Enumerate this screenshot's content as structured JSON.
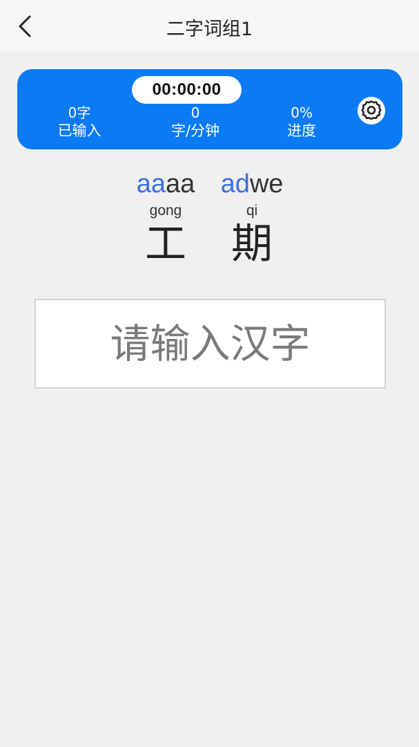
{
  "header": {
    "title": "二字词组1",
    "back_icon": "chevron-left-icon"
  },
  "stats": {
    "timer": "00:00:00",
    "typed_value": "0字",
    "typed_label": "已输入",
    "speed_value": "0",
    "speed_label": "字/分钟",
    "progress_value": "0%",
    "progress_label": "进度",
    "settings_icon": "gear-icon",
    "card_color": "#0a7af5"
  },
  "words": [
    {
      "code_highlight": "aa",
      "code_rest": "aa",
      "pinyin": "gong",
      "hanzi": "工"
    },
    {
      "code_highlight": "ad",
      "code_rest": "we",
      "pinyin": "qi",
      "hanzi": "期"
    }
  ],
  "input": {
    "value": "",
    "placeholder": "请输入汉字"
  }
}
